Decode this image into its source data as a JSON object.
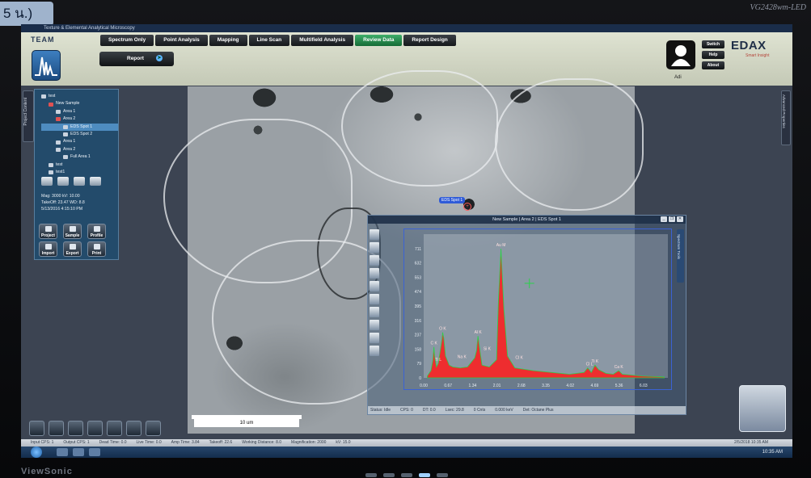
{
  "monitor": {
    "corner_tag": "5 น.)",
    "model_label": "VG2428wm-LED",
    "brand": "ViewSonic"
  },
  "window": {
    "title": "Texture & Elemental Analytical Microscopy"
  },
  "header": {
    "team_label": "TEAM",
    "nav_tabs": [
      "Spectrum Only",
      "Point Analysis",
      "Mapping",
      "Line Scan",
      "Multifield Analysis",
      "Review Data",
      "Report Design"
    ],
    "active_tab": "Review Data",
    "report_button": "Report",
    "user": {
      "name": "Adi",
      "buttons": [
        "Switch User",
        "Help",
        "About"
      ]
    },
    "brand": {
      "name": "EDAX",
      "tagline": "Smart Insight"
    }
  },
  "project_panel": {
    "side_tab": "Project Content",
    "tree": [
      {
        "label": "test",
        "level": 0,
        "icon": "project-icon"
      },
      {
        "label": "New Sample",
        "level": 1,
        "icon": "sample-icon",
        "red": true
      },
      {
        "label": "Area 1",
        "level": 2,
        "icon": "area-icon"
      },
      {
        "label": "Area 2",
        "level": 2,
        "icon": "area-icon",
        "red": true
      },
      {
        "label": "EDS Spot 1",
        "level": 3,
        "icon": "spectrum-icon",
        "selected": true
      },
      {
        "label": "EDS Spot 2",
        "level": 3,
        "icon": "spectrum-icon"
      },
      {
        "label": "Area 1",
        "level": 2,
        "icon": "area-icon"
      },
      {
        "label": "Area 2",
        "level": 2,
        "icon": "area-icon"
      },
      {
        "label": "Full Area 1",
        "level": 3,
        "icon": "spectrum-icon"
      },
      {
        "label": "test",
        "level": 1,
        "icon": "sample-icon"
      },
      {
        "label": "test1",
        "level": 1,
        "icon": "sample-icon"
      }
    ],
    "info_lines": [
      "Mag: 3000  kV: 10.00",
      "TakeOff: 23.47  WD: 8.8",
      "5/13/2016 4:15:10 PM"
    ],
    "actions": [
      "Project",
      "Sample",
      "Profile",
      "Import",
      "Export",
      "Print"
    ]
  },
  "image": {
    "scale_label": "10 um",
    "spot_label": "EDS Spot 1"
  },
  "spectrum_window": {
    "title": "New Sample | Area 2 | EDS Spot 1",
    "side_tab": "Spectrum Tools",
    "status": [
      "Status: Idle",
      "CPS: 0",
      "DT: 0.0",
      "Lsec: 29.8",
      "0 Cnts",
      "0.000 keV",
      "Det: Octane Plus"
    ]
  },
  "chart_data": {
    "type": "line",
    "title": "",
    "xlabel": "",
    "ylabel": "",
    "x_ticks": [
      "0.00",
      "0.67",
      "1.34",
      "2.01",
      "2.68",
      "3.35",
      "4.02",
      "4.69",
      "5.36",
      "6.03"
    ],
    "y_ticks": [
      "711",
      "632",
      "553",
      "474",
      "395",
      "316",
      "237",
      "158",
      "79",
      "0"
    ],
    "xlim": [
      0,
      6.7
    ],
    "ylim": [
      0,
      790
    ],
    "grid": false,
    "series": [
      {
        "color": "#ff1a1a",
        "x": [
          0.1,
          0.2,
          0.25,
          0.28,
          0.3,
          0.35,
          0.4,
          0.5,
          0.52,
          0.55,
          0.6,
          0.7,
          0.8,
          1.0,
          1.2,
          1.3,
          1.4,
          1.45,
          1.49,
          1.55,
          1.6,
          1.8,
          2.0,
          2.05,
          2.12,
          2.2,
          2.3,
          2.5,
          3.0,
          3.5,
          4.0,
          4.4,
          4.5,
          4.6,
          4.7,
          4.8,
          5.0,
          5.2,
          5.35,
          5.45,
          6.0,
          6.6
        ],
        "y": [
          10,
          40,
          95,
          170,
          120,
          60,
          80,
          210,
          250,
          220,
          120,
          70,
          60,
          55,
          60,
          85,
          110,
          150,
          230,
          140,
          70,
          60,
          100,
          420,
          710,
          380,
          120,
          55,
          40,
          30,
          20,
          30,
          55,
          30,
          70,
          45,
          25,
          20,
          40,
          20,
          10,
          5
        ]
      }
    ],
    "annotations": [
      "Au M",
      "O K",
      "C K",
      "Na K",
      "Ti L",
      "Al K",
      "Si K",
      "Cl K",
      "Cl L",
      "Ti K",
      "Ca K"
    ]
  },
  "right_panel": {
    "side_tab": "Advanced Properties"
  },
  "footer": {
    "stats": [
      "Input CPS: 1",
      "Output CPS: 1",
      "Dead Time: 0.0",
      "Live Time: 0.0",
      "Amp Time: 3.84",
      "Takeoff: 22.6",
      "Working Distance: 8.0",
      "Magnification: 2000",
      "kV: 15.0"
    ],
    "date": "2/5/2018 10:35 AM",
    "clock": "10:35 AM"
  }
}
